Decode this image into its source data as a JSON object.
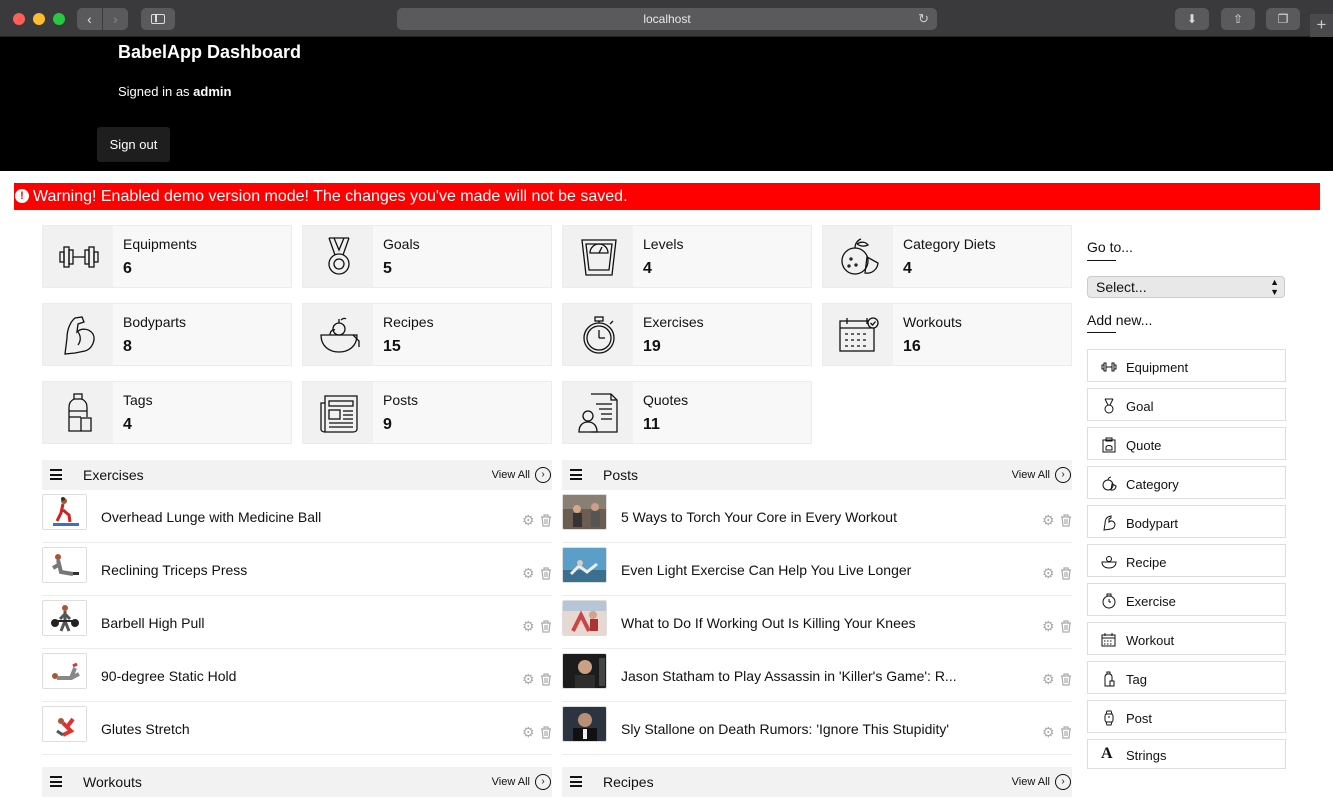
{
  "browser": {
    "url": "localhost"
  },
  "header": {
    "app_title": "BabelApp Dashboard",
    "signed_in_prefix": "Signed in as ",
    "signed_in_user": "admin",
    "sign_out_label": "Sign out"
  },
  "warning": {
    "text": "Warning! Enabled demo version mode! The changes you've made will not be saved."
  },
  "stats": [
    {
      "label": "Equipments",
      "count": "6",
      "icon": "dumbbell-icon"
    },
    {
      "label": "Goals",
      "count": "5",
      "icon": "medal-icon"
    },
    {
      "label": "Levels",
      "count": "4",
      "icon": "scale-icon"
    },
    {
      "label": "Category Diets",
      "count": "4",
      "icon": "fruit-icon"
    },
    {
      "label": "Bodyparts",
      "count": "8",
      "icon": "bicep-icon"
    },
    {
      "label": "Recipes",
      "count": "15",
      "icon": "bowl-icon"
    },
    {
      "label": "Exercises",
      "count": "19",
      "icon": "stopwatch-icon"
    },
    {
      "label": "Workouts",
      "count": "16",
      "icon": "calendar-icon"
    },
    {
      "label": "Tags",
      "count": "4",
      "icon": "bottle-icon"
    },
    {
      "label": "Posts",
      "count": "9",
      "icon": "newspaper-icon"
    },
    {
      "label": "Quotes",
      "count": "11",
      "icon": "document-person-icon"
    }
  ],
  "panels": {
    "exercises": {
      "title": "Exercises",
      "view_all": "View All",
      "items": [
        "Overhead Lunge with Medicine Ball",
        "Reclining Triceps Press",
        "Barbell High Pull",
        "90-degree Static Hold",
        "Glutes Stretch"
      ]
    },
    "posts": {
      "title": "Posts",
      "view_all": "View All",
      "items": [
        "5 Ways to Torch Your Core in Every Workout",
        "Even Light Exercise Can Help You Live Longer",
        "What to Do If Working Out Is Killing Your Knees",
        "Jason Statham to Play Assassin in 'Killer's Game': R...",
        "Sly Stallone on Death Rumors: 'Ignore This Stupidity'"
      ]
    },
    "workouts": {
      "title": "Workouts",
      "view_all": "View All"
    },
    "recipes": {
      "title": "Recipes",
      "view_all": "View All"
    }
  },
  "sidebar": {
    "goto_label": "Go to...",
    "select_value": "Select...",
    "add_new_label": "Add new...",
    "add_buttons": [
      {
        "label": "Equipment",
        "icon": "dumbbell-icon"
      },
      {
        "label": "Goal",
        "icon": "medal-icon"
      },
      {
        "label": "Quote",
        "icon": "clipboard-icon"
      },
      {
        "label": "Category",
        "icon": "fruit-icon"
      },
      {
        "label": "Bodypart",
        "icon": "bicep-icon"
      },
      {
        "label": "Recipe",
        "icon": "bowl-icon"
      },
      {
        "label": "Exercise",
        "icon": "stopwatch-icon"
      },
      {
        "label": "Workout",
        "icon": "calendar-icon"
      },
      {
        "label": "Tag",
        "icon": "bottle-icon"
      },
      {
        "label": "Post",
        "icon": "watch-icon"
      },
      {
        "label": "Strings",
        "icon": "font-icon"
      }
    ]
  },
  "colors": {
    "warning_bg": "#ff0000",
    "header_bg": "#000000"
  }
}
